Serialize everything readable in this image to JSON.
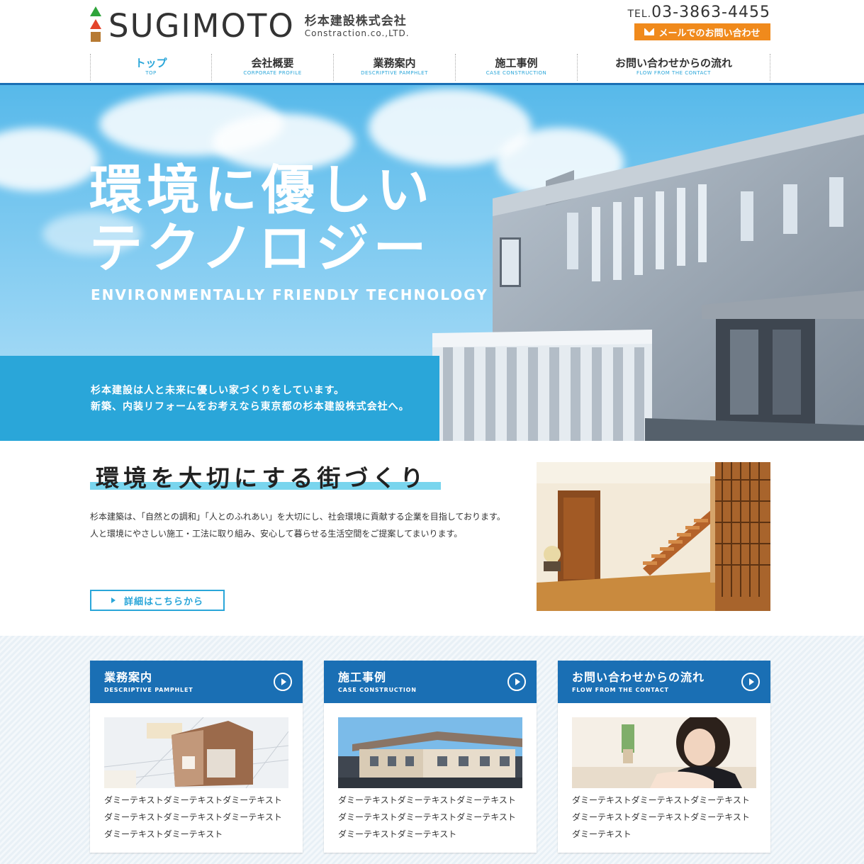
{
  "header": {
    "logo_text": "SUGIMOTO",
    "company_jp": "杉本建設株式会社",
    "company_en": "Constraction.co.,LTD.",
    "tel_prefix": "TEL.",
    "tel_number": "03-3863-4455",
    "mail_button": "メールでのお問い合わせ"
  },
  "nav": [
    {
      "jp": "トップ",
      "en": "TOP"
    },
    {
      "jp": "会社概要",
      "en": "CORPORATE PROFILE"
    },
    {
      "jp": "業務案内",
      "en": "DESCRIPTIVE PAMPHLET"
    },
    {
      "jp": "施工事例",
      "en": "CASE CONSTRUCTION"
    },
    {
      "jp": "お問い合わせからの流れ",
      "en": "FLOW FROM THE CONTACT"
    }
  ],
  "hero": {
    "title_line1": "環境に優しい",
    "title_line2": "テクノロジー",
    "title_en": "ENVIRONMENTALLY FRIENDLY TECHNOLOGY",
    "copy_line1": "杉本建設は人と未来に優しい家づくりをしています。",
    "copy_line2": "新築、内装リフォームをお考えなら東京都の杉本建設株式会社へ。"
  },
  "intro": {
    "title": "環境を大切にする街づくり",
    "text_line1": "杉本建築は、「自然との調和」「人とのふれあい」を大切にし、社会環境に貢献する企業を目指しております。",
    "text_line2": "人と環境にやさしい施工・工法に取り組み、安心して暮らせる生活空間をご提案してまいります。",
    "button": "詳細はこちらから"
  },
  "cards": [
    {
      "jp": "業務案内",
      "en": "DESCRIPTIVE PAMPHLET",
      "text": "ダミーテキストダミーテキストダミーテキストダミーテキストダミーテキストダミーテキストダミーテキストダミーテキスト"
    },
    {
      "jp": "施工事例",
      "en": "CASE CONSTRUCTION",
      "text": "ダミーテキストダミーテキストダミーテキストダミーテキストダミーテキストダミーテキストダミーテキストダミーテキスト"
    },
    {
      "jp": "お問い合わせからの流れ",
      "en": "FLOW FROM THE CONTACT",
      "text": "ダミーテキストダミーテキストダミーテキストダミーテキストダミーテキストダミーテキストダミーテキスト"
    }
  ]
}
